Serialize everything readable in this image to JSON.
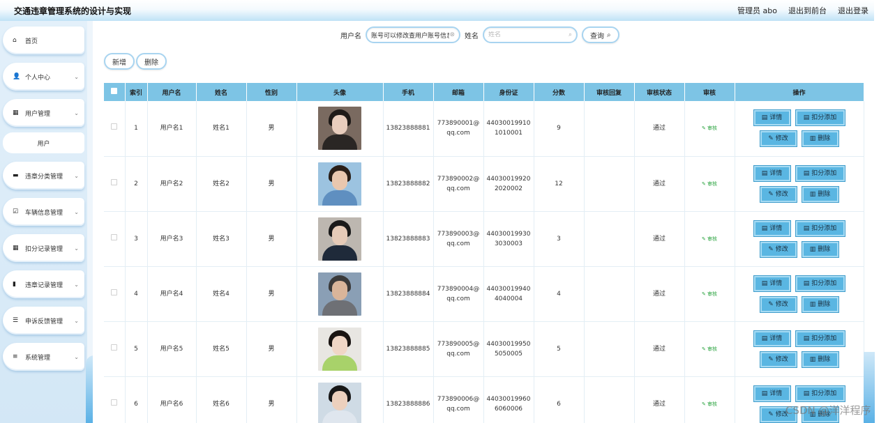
{
  "header": {
    "title": "交通违章管理系统的设计与实现",
    "admin_label": "管理员 abo",
    "front_link": "退出到前台",
    "logout_link": "退出登录"
  },
  "sidebar": {
    "items": [
      {
        "label": "首页",
        "icon": "home-icon",
        "glyph": "⌂",
        "has_arrow": false
      },
      {
        "label": "个人中心",
        "icon": "user-icon",
        "glyph": "👤",
        "has_arrow": true
      },
      {
        "label": "用户管理",
        "icon": "grid-icon",
        "glyph": "▦",
        "has_arrow": true
      },
      {
        "label": "违章分类管理",
        "icon": "monitor-icon",
        "glyph": "▬",
        "has_arrow": true
      },
      {
        "label": "车辆信息管理",
        "icon": "checkbox-icon",
        "glyph": "☑",
        "has_arrow": true
      },
      {
        "label": "扣分记录管理",
        "icon": "grid-icon",
        "glyph": "▦",
        "has_arrow": true
      },
      {
        "label": "违章记录管理",
        "icon": "bar-chart-icon",
        "glyph": "▮",
        "has_arrow": true
      },
      {
        "label": "申诉反馈管理",
        "icon": "list-icon",
        "glyph": "☰",
        "has_arrow": true
      },
      {
        "label": "系统管理",
        "icon": "menu-icon",
        "glyph": "≡",
        "has_arrow": true
      }
    ],
    "sub_item": "用户"
  },
  "search": {
    "username_label": "用户名",
    "username_value": "账号可以修改查用户账号信息",
    "name_label": "姓名",
    "name_placeholder": "姓名",
    "query_button": "查询"
  },
  "actions": {
    "add_button": "新增",
    "delete_button": "删除"
  },
  "table": {
    "columns": [
      "索引",
      "用户名",
      "姓名",
      "性别",
      "头像",
      "手机",
      "邮箱",
      "身份证",
      "分数",
      "审核回复",
      "审核状态",
      "审核",
      "操作"
    ],
    "rows": [
      {
        "index": "1",
        "username": "用户名1",
        "name": "姓名1",
        "gender": "男",
        "phone": "13823888881",
        "email_1": "773890001@",
        "email_2": "qq.com",
        "id_1": "44030019910",
        "id_2": "1010001",
        "score": "9",
        "reply": "",
        "status": "通过"
      },
      {
        "index": "2",
        "username": "用户名2",
        "name": "姓名2",
        "gender": "男",
        "phone": "13823888882",
        "email_1": "773890002@",
        "email_2": "qq.com",
        "id_1": "44030019920",
        "id_2": "2020002",
        "score": "12",
        "reply": "",
        "status": "通过"
      },
      {
        "index": "3",
        "username": "用户名3",
        "name": "姓名3",
        "gender": "男",
        "phone": "13823888883",
        "email_1": "773890003@",
        "email_2": "qq.com",
        "id_1": "44030019930",
        "id_2": "3030003",
        "score": "3",
        "reply": "",
        "status": "通过"
      },
      {
        "index": "4",
        "username": "用户名4",
        "name": "姓名4",
        "gender": "男",
        "phone": "13823888884",
        "email_1": "773890004@",
        "email_2": "qq.com",
        "id_1": "44030019940",
        "id_2": "4040004",
        "score": "4",
        "reply": "",
        "status": "通过"
      },
      {
        "index": "5",
        "username": "用户名5",
        "name": "姓名5",
        "gender": "男",
        "phone": "13823888885",
        "email_1": "773890005@",
        "email_2": "qq.com",
        "id_1": "44030019950",
        "id_2": "5050005",
        "score": "5",
        "reply": "",
        "status": "通过"
      },
      {
        "index": "6",
        "username": "用户名6",
        "name": "姓名6",
        "gender": "男",
        "phone": "13823888886",
        "email_1": "773890006@",
        "email_2": "qq.com",
        "id_1": "44030019960",
        "id_2": "6060006",
        "score": "6",
        "reply": "",
        "status": "通过"
      }
    ],
    "row_buttons": {
      "audit": "审核",
      "detail": "详情",
      "deduct": "扣分添加",
      "edit": "修改",
      "delete": "删除"
    },
    "avatar_colors": [
      {
        "hair": "#1e1a18",
        "face": "#e8cdbd",
        "body": "#2a2624",
        "bg": "#7a6a60"
      },
      {
        "hair": "#2a1f18",
        "face": "#e9c7ae",
        "body": "#5f8fc0",
        "bg": "#9cc3e0"
      },
      {
        "hair": "#1a1a1a",
        "face": "#e6cbb8",
        "body": "#1f2a3a",
        "bg": "#bdb7b0"
      },
      {
        "hair": "#3a3a3a",
        "face": "#d9b59a",
        "body": "#6e7075",
        "bg": "#8a9fb5"
      },
      {
        "hair": "#1a1412",
        "face": "#f0d6c6",
        "body": "#a8d26a",
        "bg": "#e8e6e2"
      },
      {
        "hair": "#181818",
        "face": "#ecd0bd",
        "body": "#dfe6ee",
        "bg": "#cfdbe5"
      }
    ]
  },
  "watermark": "CSDN @洋洋程序",
  "colors": {
    "accent": "#7dc4e5",
    "button": "#5ab6e2",
    "audit_green": "#2aa33f"
  }
}
